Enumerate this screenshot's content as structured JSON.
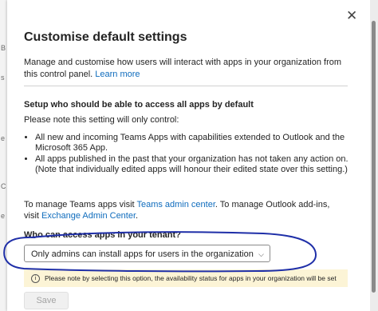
{
  "backdrop": {
    "fragments": [
      "B",
      "s",
      "e",
      "C",
      "e"
    ]
  },
  "panel": {
    "title": "Customise default settings",
    "intro": "Manage and customise how users will interact with apps in your organization from this control panel.",
    "learn_more": "Learn more",
    "section_title": "Setup who should be able to access all apps by default",
    "note": "Please note this setting will only control:",
    "bullets": [
      "All new and incoming Teams Apps with capabilities extended to Outlook and the Microsoft 365 App.",
      "All apps published in the past that your organization has not taken any action on. (Note that individually edited apps will honour their edited state over this setting.)"
    ],
    "manage_prefix": "To manage Teams apps visit",
    "teams_admin_link": "Teams admin center",
    "manage_middle": ". To manage Outlook add-ins, visit",
    "exchange_link": "Exchange Admin Center",
    "manage_suffix": ".",
    "access_question": "Who can access apps in your tenant?",
    "access_selected": "Only admins can install apps for users in the organization",
    "warning": "Please note by selecting this option, the availability status for apps in your organization will be set",
    "save_label": "Save"
  },
  "icons": {
    "close": "close-icon",
    "dropdown": "chevron-down-icon",
    "info": "info-icon"
  },
  "colors": {
    "link": "#0f6cbd",
    "annotation_ink": "#1f2fa8",
    "warning_bg": "#fcf4d6"
  }
}
